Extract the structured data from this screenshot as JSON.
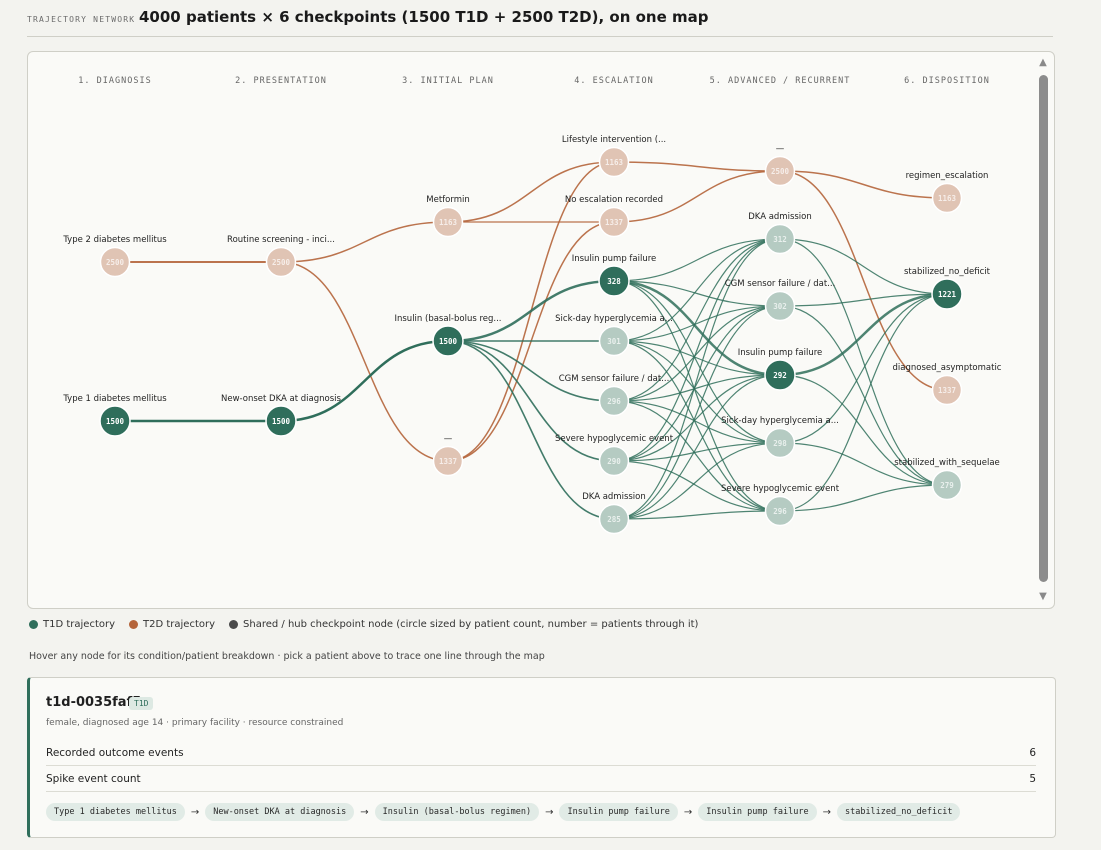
{
  "header": {
    "kicker": "TRAJECTORY NETWORK",
    "title": "4000 patients × 6 checkpoints (1500 T1D + 2500 T2D), on one map"
  },
  "colors": {
    "t1d": "#2f6e5b",
    "t1d_light": "#b5cbc2",
    "t2d": "#b4643a",
    "t2d_light": "#e0c4b4",
    "hub": "#4a4a4a"
  },
  "columns": [
    "1. DIAGNOSIS",
    "2. PRESENTATION",
    "3. INITIAL PLAN",
    "4. ESCALATION",
    "5. ADVANCED / RECURRENT",
    "6. DISPOSITION"
  ],
  "nodes": [
    {
      "id": "t2d-diag",
      "label": "Type 2 diabetes mellitus",
      "count": "2500",
      "type": "t2d",
      "hi": false
    },
    {
      "id": "t1d-diag",
      "label": "Type 1 diabetes mellitus",
      "count": "1500",
      "type": "t1d",
      "hi": true
    },
    {
      "id": "t2d-pres",
      "label": "Routine screening - inci...",
      "count": "2500",
      "type": "t2d",
      "hi": false
    },
    {
      "id": "t1d-pres",
      "label": "New-onset DKA at diagnosis",
      "count": "1500",
      "type": "t1d",
      "hi": true
    },
    {
      "id": "metformin",
      "label": "Metformin",
      "count": "1163",
      "type": "t2d",
      "hi": false
    },
    {
      "id": "insulin-bb",
      "label": "Insulin (basal-bolus reg...",
      "count": "1500",
      "type": "t1d",
      "hi": true
    },
    {
      "id": "plan-dash",
      "label": "—",
      "count": "1337",
      "type": "t2d",
      "hi": false
    },
    {
      "id": "lifestyle",
      "label": "Lifestyle intervention (...",
      "count": "1163",
      "type": "t2d",
      "hi": false
    },
    {
      "id": "no-esc",
      "label": "No escalation recorded",
      "count": "1337",
      "type": "t2d",
      "hi": false
    },
    {
      "id": "e-pump",
      "label": "Insulin pump failure",
      "count": "328",
      "type": "t1d",
      "hi": true
    },
    {
      "id": "e-sick",
      "label": "Sick-day hyperglycemia a...",
      "count": "301",
      "type": "t1d",
      "hi": false
    },
    {
      "id": "e-cgm",
      "label": "CGM sensor failure / dat...",
      "count": "296",
      "type": "t1d",
      "hi": false
    },
    {
      "id": "e-hypo",
      "label": "Severe hypoglycemic event",
      "count": "290",
      "type": "t1d",
      "hi": false
    },
    {
      "id": "e-dka",
      "label": "DKA admission",
      "count": "285",
      "type": "t1d",
      "hi": false
    },
    {
      "id": "adv-dash",
      "label": "—",
      "count": "2500",
      "type": "t2d",
      "hi": false
    },
    {
      "id": "a-dka",
      "label": "DKA admission",
      "count": "312",
      "type": "t1d",
      "hi": false
    },
    {
      "id": "a-cgm",
      "label": "CGM sensor failure / dat...",
      "count": "302",
      "type": "t1d",
      "hi": false
    },
    {
      "id": "a-pump",
      "label": "Insulin pump failure",
      "count": "292",
      "type": "t1d",
      "hi": true
    },
    {
      "id": "a-sick",
      "label": "Sick-day hyperglycemia a...",
      "count": "298",
      "type": "t1d",
      "hi": false
    },
    {
      "id": "a-hypo",
      "label": "Severe hypoglycemic event",
      "count": "296",
      "type": "t1d",
      "hi": false
    },
    {
      "id": "regimen",
      "label": "regimen_escalation",
      "count": "1163",
      "type": "t2d",
      "hi": false
    },
    {
      "id": "stab-no",
      "label": "stabilized_no_deficit",
      "count": "1221",
      "type": "t1d",
      "hi": true
    },
    {
      "id": "diag-asym",
      "label": "diagnosed_asymptomatic",
      "count": "1337",
      "type": "t2d",
      "hi": false
    },
    {
      "id": "stab-seq",
      "label": "stabilized_with_sequelae",
      "count": "279",
      "type": "t1d",
      "hi": false
    }
  ],
  "legend": {
    "t1d": "T1D trajectory",
    "t2d": "T2D trajectory",
    "hub": "Shared / hub checkpoint node (circle sized by patient count, number = patients through it)"
  },
  "hint": "Hover any node for its condition/patient breakdown · pick a patient above to trace one line through the map",
  "patient": {
    "id": "t1d-0035faf5",
    "badge": "T1D",
    "meta": "female, diagnosed age 14 · primary facility · resource constrained",
    "rows": [
      {
        "label": "Recorded outcome events",
        "value": "6"
      },
      {
        "label": "Spike event count",
        "value": "5"
      }
    ],
    "path": [
      "Type 1 diabetes mellitus",
      "New-onset DKA at diagnosis",
      "Insulin (basal-bolus regimen)",
      "Insulin pump failure",
      "Insulin pump failure",
      "stabilized_no_deficit"
    ],
    "arrow": "→"
  },
  "scroll": {
    "up": "▲",
    "down": "▼"
  }
}
